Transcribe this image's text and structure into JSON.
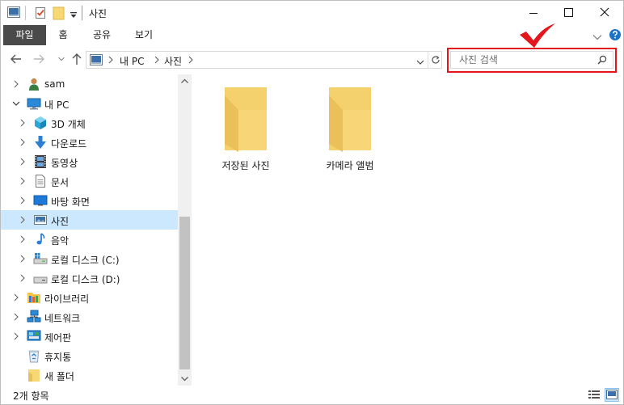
{
  "window": {
    "title": "사진"
  },
  "ribbon": {
    "tabs": [
      "파일",
      "홈",
      "공유",
      "보기"
    ]
  },
  "address": {
    "path": [
      "내 PC",
      "사진"
    ]
  },
  "search": {
    "placeholder": "사진 검색"
  },
  "nav_tree": [
    {
      "label": "sam",
      "icon": "user-icon",
      "chevron": "right",
      "indent": 0
    },
    {
      "label": "내 PC",
      "icon": "computer-icon",
      "chevron": "down",
      "indent": 0
    },
    {
      "label": "3D 개체",
      "icon": "cube-3d-icon",
      "chevron": "right",
      "indent": 1
    },
    {
      "label": "다운로드",
      "icon": "download-arrow-icon",
      "chevron": "right",
      "indent": 1
    },
    {
      "label": "동영상",
      "icon": "video-film-icon",
      "chevron": "right",
      "indent": 1
    },
    {
      "label": "문서",
      "icon": "document-icon",
      "chevron": "right",
      "indent": 1
    },
    {
      "label": "바탕 화면",
      "icon": "desktop-icon",
      "chevron": "right",
      "indent": 1
    },
    {
      "label": "사진",
      "icon": "pictures-icon",
      "chevron": "right",
      "indent": 1,
      "selected": true
    },
    {
      "label": "음악",
      "icon": "music-note-icon",
      "chevron": "right",
      "indent": 1
    },
    {
      "label": "로컬 디스크 (C:)",
      "icon": "windows-drive-icon",
      "chevron": "right",
      "indent": 1
    },
    {
      "label": "로컬 디스크 (D:)",
      "icon": "drive-icon",
      "chevron": "right",
      "indent": 1
    },
    {
      "label": "라이브러리",
      "icon": "library-icon",
      "chevron": "right",
      "indent": 0
    },
    {
      "label": "네트워크",
      "icon": "network-icon",
      "chevron": "right",
      "indent": 0
    },
    {
      "label": "제어판",
      "icon": "control-panel-icon",
      "chevron": "right",
      "indent": 0
    },
    {
      "label": "휴지통",
      "icon": "recycle-bin-icon",
      "chevron": "none",
      "indent": 0
    },
    {
      "label": "새 폴더",
      "icon": "folder-icon",
      "chevron": "none",
      "indent": 0
    }
  ],
  "folders": [
    {
      "label": "저장된 사진"
    },
    {
      "label": "카메라 앨범"
    }
  ],
  "status": {
    "item_count": "2개 항목"
  },
  "colors": {
    "accent_selected": "#cce8ff",
    "file_tab": "#4a4a4a",
    "highlight": "#e3161b",
    "folder": "#f8d775"
  }
}
